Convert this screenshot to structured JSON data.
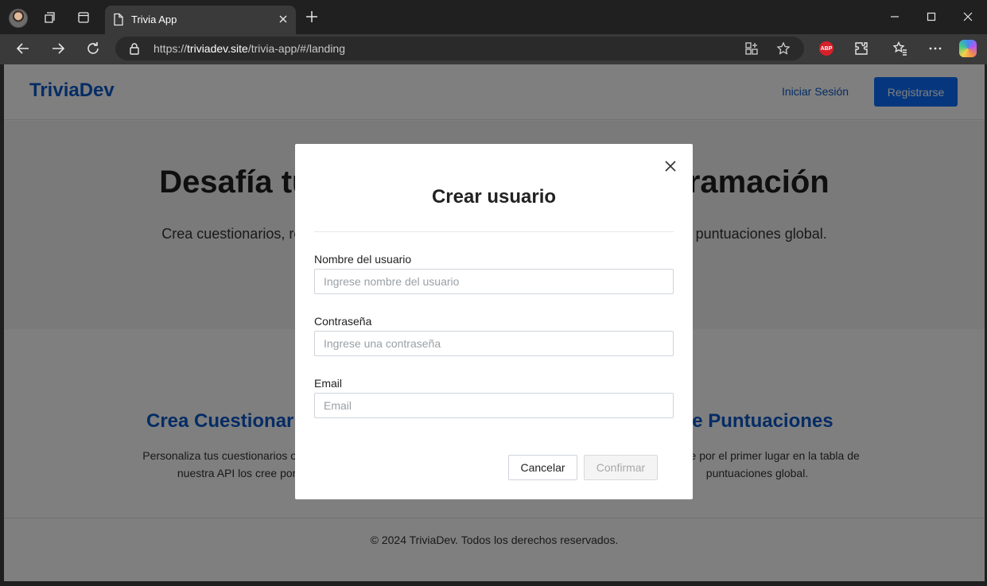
{
  "browser": {
    "tab_title": "Trivia App",
    "url_prefix": "https://",
    "url_host": "triviadev.site",
    "url_path": "/trivia-app/#/landing",
    "extension_badge": "ABP"
  },
  "site": {
    "brand": "TriviaDev",
    "nav": {
      "login": "Iniciar Sesión",
      "register": "Registrarse"
    },
    "hero": {
      "title": "Desafía tus conocimientos de programación",
      "subtitle": "Crea cuestionarios, responde preguntas y compite por el primer lugar en la tabla de puntuaciones global."
    },
    "features": [
      {
        "title": "Crea Cuestionarios",
        "description": "Personaliza tus cuestionarios o deja que nuestra API los cree por ti."
      },
      {
        "title": "Tabla de Puntuaciones",
        "description": "Compite por el primer lugar en la tabla de puntuaciones global."
      }
    ],
    "footer": "© 2024 TriviaDev. Todos los derechos reservados."
  },
  "modal": {
    "title": "Crear usuario",
    "fields": [
      {
        "label": "Nombre del usuario",
        "placeholder": "Ingrese nombre del usuario",
        "value": ""
      },
      {
        "label": "Contraseña",
        "placeholder": "Ingrese una contraseña",
        "value": ""
      },
      {
        "label": "Email",
        "placeholder": "Email",
        "value": ""
      }
    ],
    "cancel": "Cancelar",
    "confirm": "Confirmar"
  },
  "colors": {
    "brand_blue": "#0a58ca",
    "primary_button": "#0d6efd",
    "browser_chrome": "#202020"
  }
}
